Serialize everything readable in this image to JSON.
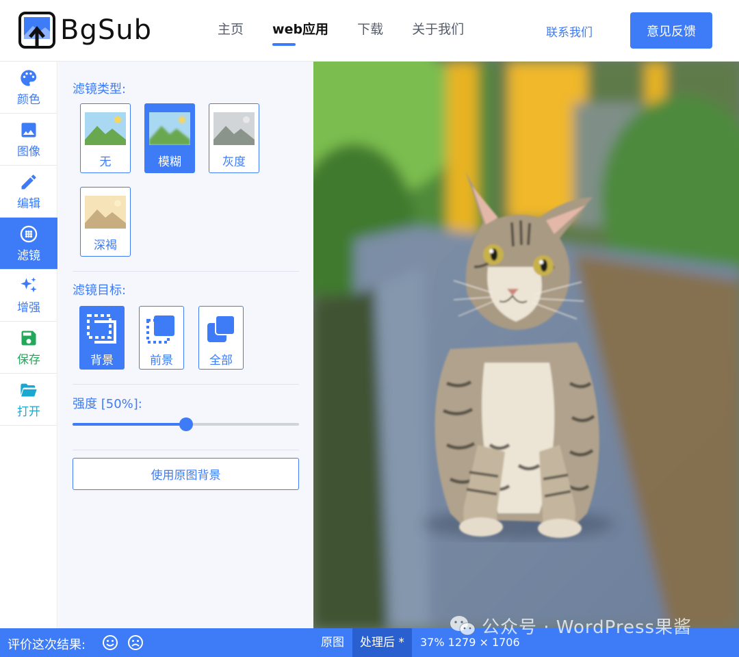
{
  "header": {
    "logo_text": "BgSub",
    "nav": [
      "主页",
      "web应用",
      "下载",
      "关于我们"
    ],
    "nav_active": 1,
    "contact_label": "联系我们",
    "feedback_label": "意见反馈"
  },
  "toolbar": {
    "items": [
      {
        "label": "颜色",
        "icon": "palette-icon"
      },
      {
        "label": "图像",
        "icon": "image-icon"
      },
      {
        "label": "编辑",
        "icon": "pencil-icon"
      },
      {
        "label": "滤镜",
        "icon": "filter-icon",
        "active": true
      },
      {
        "label": "增强",
        "icon": "sparkle-icon"
      },
      {
        "label": "保存",
        "icon": "save-icon",
        "color": "#22a85a"
      },
      {
        "label": "打开",
        "icon": "folder-open-icon",
        "color": "#19a8d0"
      }
    ]
  },
  "panel": {
    "filter_type_label": "滤镜类型:",
    "filters": [
      {
        "label": "无"
      },
      {
        "label": "模糊",
        "active": true
      },
      {
        "label": "灰度"
      },
      {
        "label": "深褐"
      }
    ],
    "filter_target_label": "滤镜目标:",
    "targets": [
      {
        "label": "背景",
        "active": true
      },
      {
        "label": "前景"
      },
      {
        "label": "全部"
      }
    ],
    "strength_label": "强度 [50%]:",
    "strength_value": 0.5,
    "use_original_bg_label": "使用原图背景"
  },
  "statusbar": {
    "rate_label": "评价这次结果:",
    "view_original": "原图",
    "view_processed": "处理后 *",
    "info": "37% 1279 × 1706"
  },
  "watermark": {
    "text": "公众号 · WordPress果酱"
  },
  "colors": {
    "accent": "#3d7bf7",
    "save": "#22a85a",
    "open": "#19a8d0"
  }
}
